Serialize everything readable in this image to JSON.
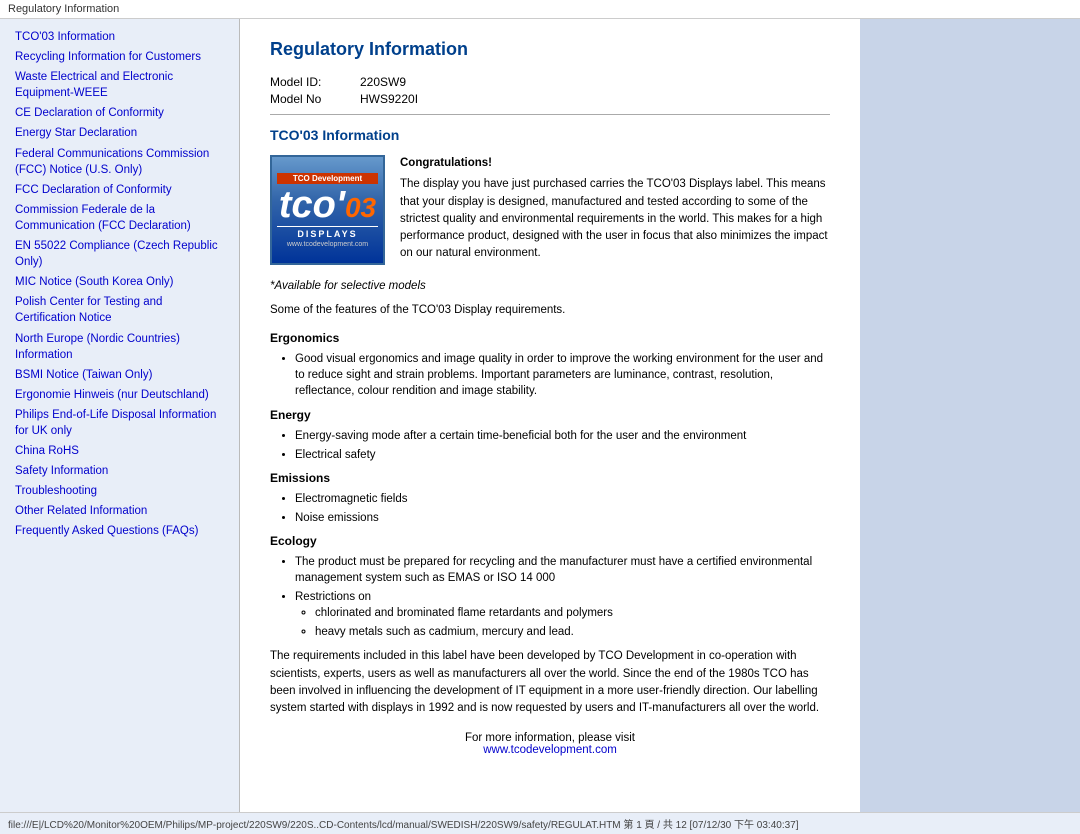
{
  "titlebar": {
    "text": "Regulatory Information"
  },
  "sidebar": {
    "links": [
      {
        "id": "tco03",
        "label": "TCO'03 Information"
      },
      {
        "id": "recycling",
        "label": "Recycling Information for Customers"
      },
      {
        "id": "weee",
        "label": "Waste Electrical and Electronic Equipment-WEEE"
      },
      {
        "id": "ce",
        "label": "CE Declaration of Conformity"
      },
      {
        "id": "energy-star",
        "label": "Energy Star Declaration"
      },
      {
        "id": "fcc",
        "label": "Federal Communications Commission (FCC) Notice (U.S. Only)"
      },
      {
        "id": "fcc-declaration",
        "label": "FCC Declaration of Conformity"
      },
      {
        "id": "commission-fed",
        "label": "Commission Federale de la Communication (FCC Declaration)"
      },
      {
        "id": "en55022",
        "label": "EN 55022 Compliance (Czech Republic Only)"
      },
      {
        "id": "mic",
        "label": "MIC Notice (South Korea Only)"
      },
      {
        "id": "polish",
        "label": "Polish Center for Testing and Certification Notice"
      },
      {
        "id": "north-europe",
        "label": "North Europe (Nordic Countries) Information"
      },
      {
        "id": "bsmi",
        "label": "BSMI Notice (Taiwan Only)"
      },
      {
        "id": "ergonomie",
        "label": "Ergonomie Hinweis (nur Deutschland)"
      },
      {
        "id": "philips",
        "label": "Philips End-of-Life Disposal Information for UK only"
      },
      {
        "id": "china-rohs",
        "label": "China RoHS"
      },
      {
        "id": "safety",
        "label": "Safety Information"
      },
      {
        "id": "troubleshooting",
        "label": "Troubleshooting"
      },
      {
        "id": "other",
        "label": "Other Related Information"
      },
      {
        "id": "faq",
        "label": "Frequently Asked Questions (FAQs)"
      }
    ]
  },
  "content": {
    "page_title": "Regulatory Information",
    "model_id_label": "Model ID:",
    "model_id_value": "220SW9",
    "model_no_label": "Model No",
    "model_no_value": "HWS9220I",
    "section_tco_title": "TCO'03 Information",
    "tco_logo": {
      "top_text": "TCO Development",
      "main_text": "tco'",
      "year": "03",
      "displays": "DISPLAYS",
      "url": "www.tcodevelopment.com"
    },
    "congratulations_title": "Congratulations!",
    "congratulations_text": "The display you have just purchased carries the TCO'03 Displays label. This means that your display is designed, manufactured and tested according to some of the strictest quality and environmental requirements in the world. This makes for a high performance product, designed with the user in focus that also minimizes the impact on our natural environment.",
    "available_note": "*Available for selective models",
    "features_intro": "Some of the features of the TCO'03 Display requirements.",
    "ergonomics_title": "Ergonomics",
    "ergonomics_bullet1": "Good visual ergonomics and image quality in order to improve the working environment for the user and to reduce sight and strain problems. Important parameters are luminance, contrast, resolution, reflectance, colour rendition and image stability.",
    "energy_title": "Energy",
    "energy_bullet1": "Energy-saving mode after a certain time-beneficial both for the user and the environment",
    "energy_bullet2": "Electrical safety",
    "emissions_title": "Emissions",
    "emissions_bullet1": "Electromagnetic fields",
    "emissions_bullet2": "Noise emissions",
    "ecology_title": "Ecology",
    "ecology_bullet1": "The product must be prepared for recycling and the manufacturer must have a certified environmental management system such as EMAS or ISO 14 000",
    "ecology_bullet2_main": "Restrictions on",
    "ecology_sub_bullet1": "chlorinated and brominated flame retardants and polymers",
    "ecology_sub_bullet2": "heavy metals such as cadmium, mercury and lead.",
    "tco_dev_text": "The requirements included in this label have been developed by TCO Development in co-operation with scientists, experts, users as well as manufacturers all over the world. Since the end of the 1980s TCO has been involved in influencing the development of IT equipment in a more user-friendly direction. Our labelling system started with displays in 1992 and is now requested by users and IT-manufacturers all over the world.",
    "for_more_label": "For more information, please visit",
    "for_more_link": "www.tcodevelopment.com"
  },
  "footer": {
    "text": "file:///E|/LCD%20/Monitor%20OEM/Philips/MP-project/220SW9/220S..CD-Contents/lcd/manual/SWEDISH/220SW9/safety/REGULAT.HTM 第 1 頁 / 共 12 [07/12/30 下午 03:40:37]"
  }
}
